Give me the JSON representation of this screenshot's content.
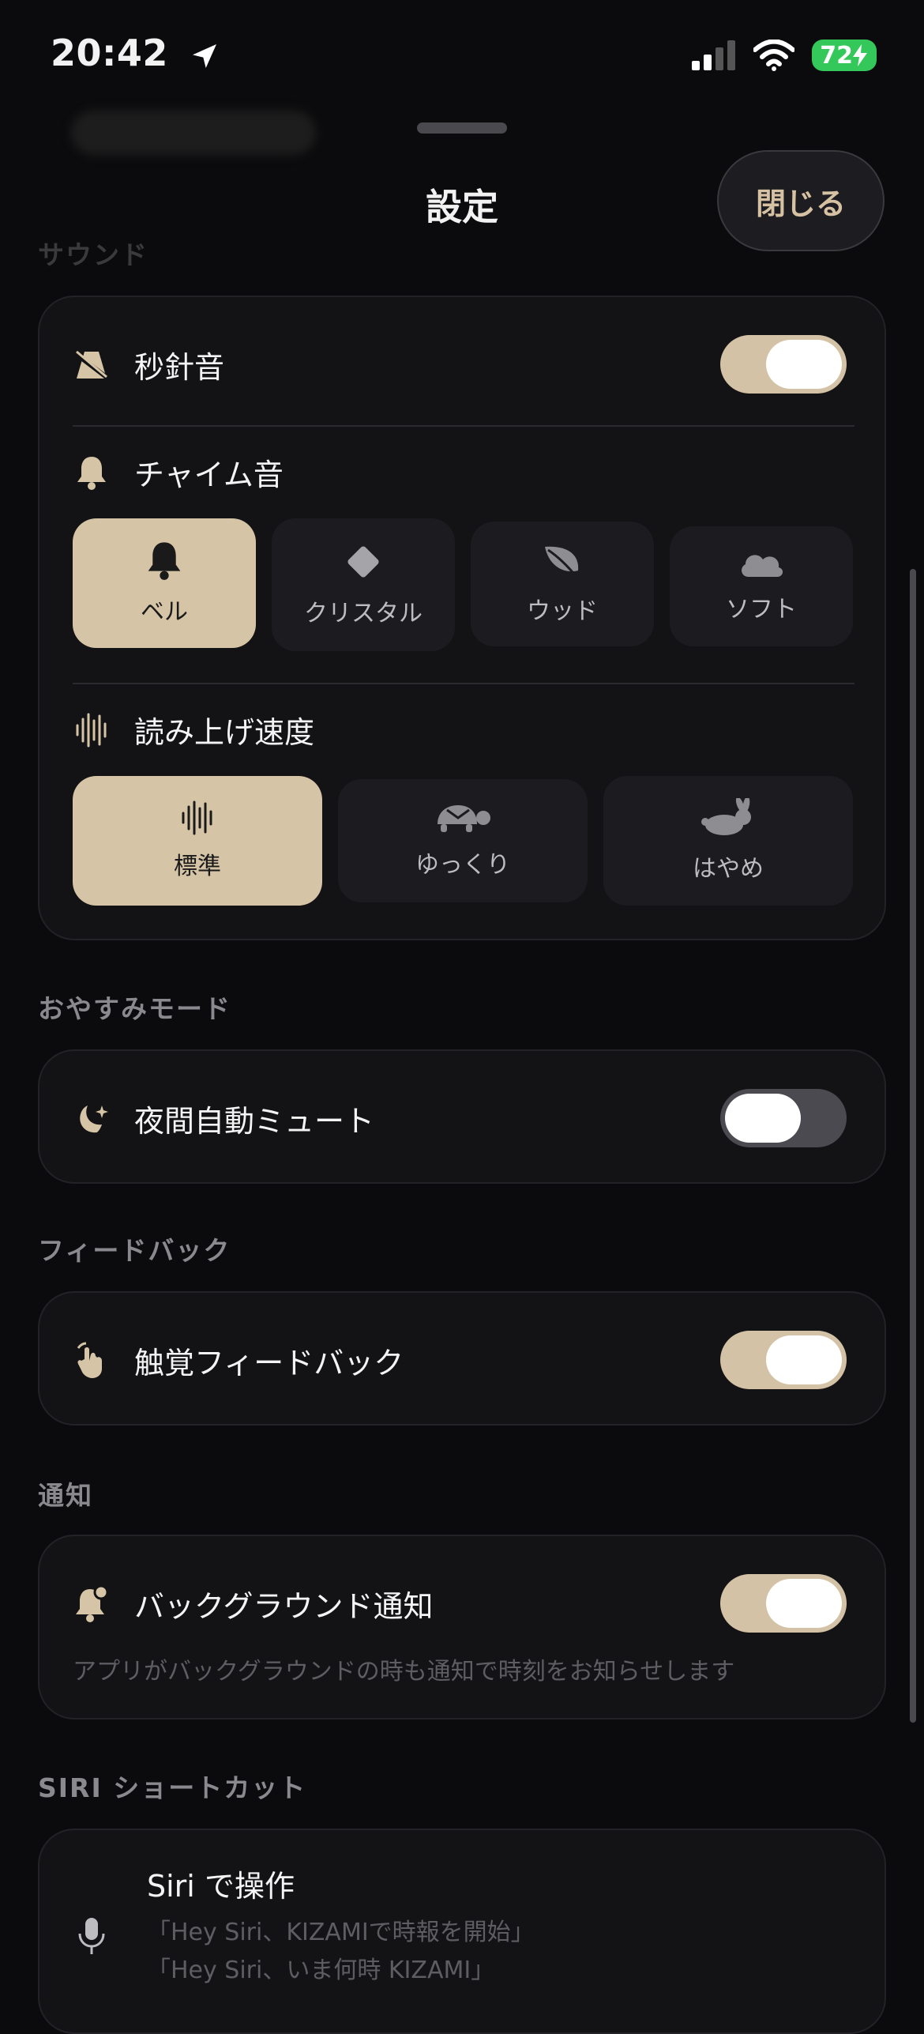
{
  "status": {
    "time": "20:42",
    "battery": "72"
  },
  "header": {
    "title": "設定",
    "close_label": "閉じる"
  },
  "sound": {
    "section_label": "サウンド",
    "second_hand": {
      "label": "秒針音",
      "on": true
    },
    "chime": {
      "label": "チャイム音",
      "options": [
        {
          "label": "ベル",
          "icon": "bell-icon",
          "selected": true
        },
        {
          "label": "クリスタル",
          "icon": "diamond-icon",
          "selected": false
        },
        {
          "label": "ウッド",
          "icon": "leaf-icon",
          "selected": false
        },
        {
          "label": "ソフト",
          "icon": "cloud-icon",
          "selected": false
        }
      ]
    },
    "speed": {
      "label": "読み上げ速度",
      "options": [
        {
          "label": "標準",
          "icon": "waveform-icon",
          "selected": true
        },
        {
          "label": "ゆっくり",
          "icon": "tortoise-icon",
          "selected": false
        },
        {
          "label": "はやめ",
          "icon": "rabbit-icon",
          "selected": false
        }
      ]
    }
  },
  "sleep": {
    "section_label": "おやすみモード",
    "night_mute": {
      "label": "夜間自動ミュート",
      "on": false
    }
  },
  "feedback": {
    "section_label": "フィードバック",
    "haptic": {
      "label": "触覚フィードバック",
      "on": true
    }
  },
  "notify": {
    "section_label": "通知",
    "background": {
      "label": "バックグラウンド通知",
      "on": true,
      "description": "アプリがバックグラウンドの時も通知で時刻をお知らせします"
    }
  },
  "siri": {
    "section_label": "SIRI ショートカット",
    "title": "Siri で操作",
    "phrase1": "「Hey Siri、KIZAMIで時報を開始」",
    "phrase2": "「Hey Siri、いま何時 KIZAMI」"
  },
  "colors": {
    "accent": "#d6c4a6",
    "background": "#0b0b0d",
    "card": "#131316"
  }
}
